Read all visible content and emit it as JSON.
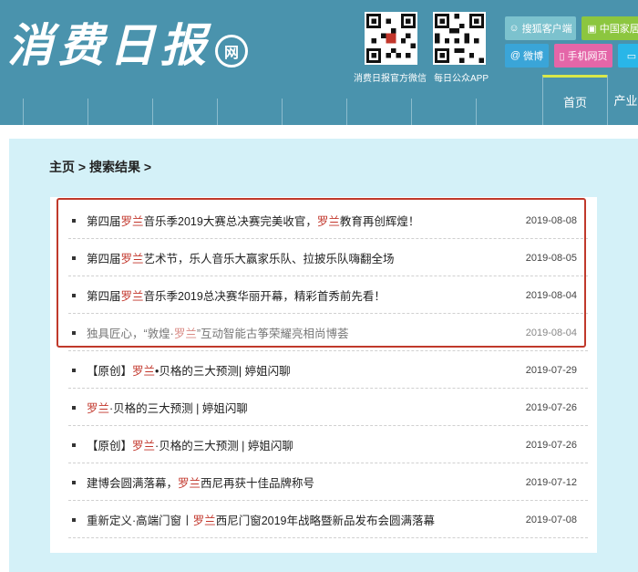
{
  "header": {
    "logo_text": "消费日报",
    "logo_badge": "网",
    "qr_caption_1": "消费日报官方微信",
    "qr_caption_2": "每日公众APP",
    "btn_client": "搜狐客户端",
    "btn_china": "中国家居",
    "btn_weibo": "微博",
    "btn_mobile": "手机网页",
    "tab_home": "首页",
    "tab_industry": "产业"
  },
  "breadcrumb": "主页 > 搜索结果 >",
  "keyword": "罗兰",
  "results": [
    {
      "pre": "第四届",
      "hl": "罗兰",
      "mid": "音乐季2019大赛总决赛完美收官，",
      "hl2": "罗兰",
      "post": "教育再创辉煌！",
      "date": "2019-08-08"
    },
    {
      "pre": "第四届",
      "hl": "罗兰",
      "mid": "艺术节，乐人音乐大赢家乐队、拉披乐队嗨翻全场",
      "hl2": "",
      "post": "",
      "date": "2019-08-05"
    },
    {
      "pre": "第四届",
      "hl": "罗兰",
      "mid": "音乐季2019总决赛华丽开幕，精彩首秀前先看！",
      "hl2": "",
      "post": "",
      "date": "2019-08-04"
    },
    {
      "pre": "独具匠心，“敦煌·",
      "hl": "罗兰",
      "mid": "”互动智能古筝荣耀亮相尚博荟",
      "hl2": "",
      "post": "",
      "date": "2019-08-04"
    },
    {
      "pre": "【原创】",
      "hl": "罗兰",
      "mid": "•贝格的三大预测| 婷姐闪聊",
      "hl2": "",
      "post": "",
      "date": "2019-07-29"
    },
    {
      "pre": "",
      "hl": "罗兰",
      "mid": "·贝格的三大预测 | 婷姐闪聊",
      "hl2": "",
      "post": "",
      "date": "2019-07-26"
    },
    {
      "pre": "【原创】",
      "hl": "罗兰",
      "mid": "·贝格的三大预测 | 婷姐闪聊",
      "hl2": "",
      "post": "",
      "date": "2019-07-26"
    },
    {
      "pre": "建博会圆满落幕，",
      "hl": "罗兰",
      "mid": "西尼再获十佳品牌称号",
      "hl2": "",
      "post": "",
      "date": "2019-07-12"
    },
    {
      "pre": "重新定义·高端门窗丨",
      "hl": "罗兰",
      "mid": "西尼门窗2019年战略暨新品发布会圆满落幕",
      "hl2": "",
      "post": "",
      "date": "2019-07-08"
    }
  ],
  "colors": {
    "header_bg": "#4a93ad",
    "content_bg": "#d4f1f8",
    "highlight": "#c2362b",
    "annotation_box": "#c0392b"
  }
}
